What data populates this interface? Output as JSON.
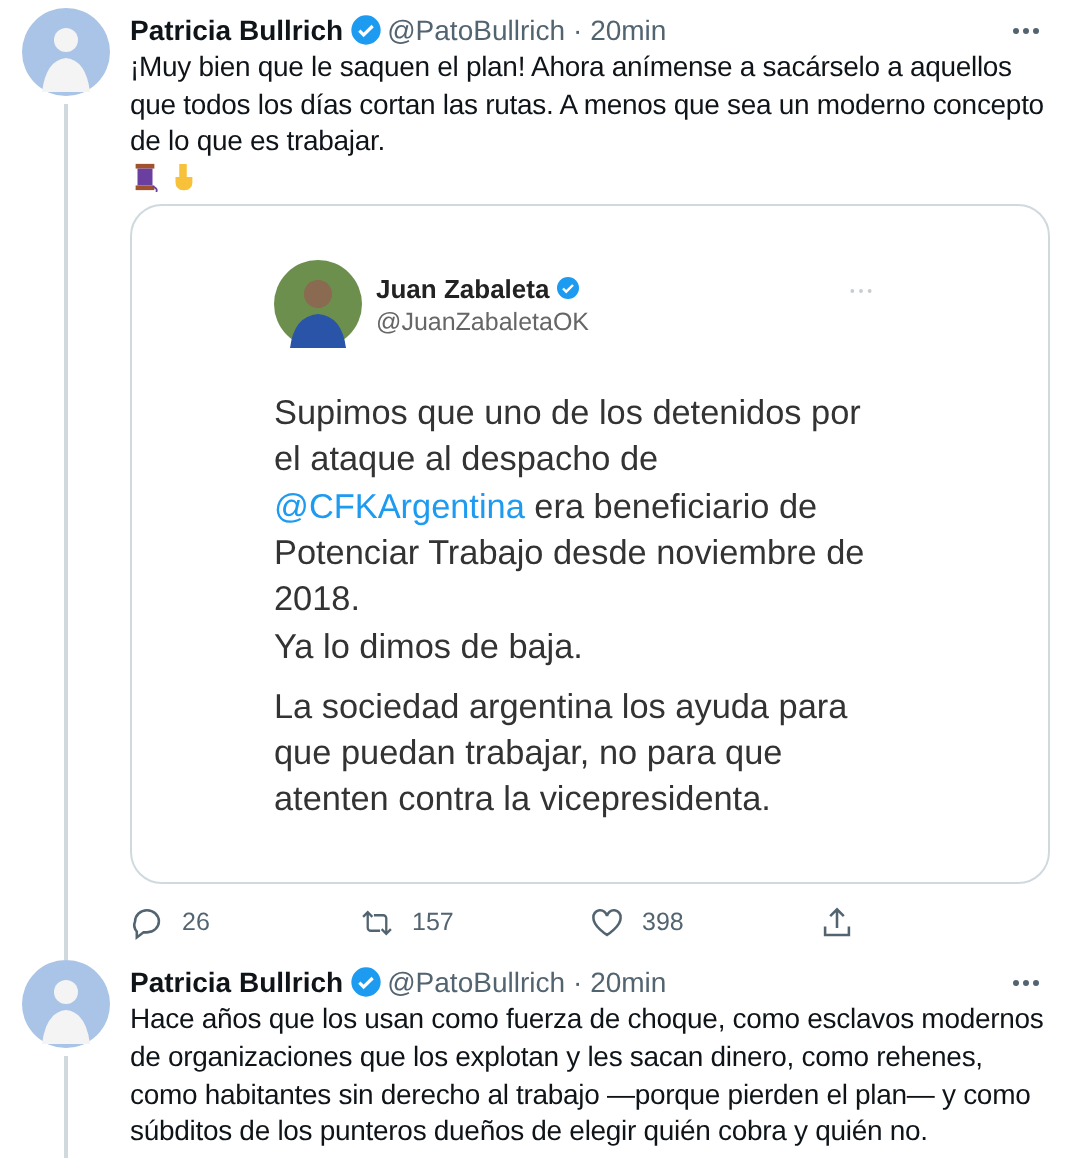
{
  "tweets": [
    {
      "name": "Patricia Bullrich",
      "verified": true,
      "handle": "@PatoBullrich",
      "time": "· 20min",
      "text": "¡Muy bien que le saquen el plan! Ahora anímense a sacárselo a aquellos que todos los días cortan las rutas. A menos que sea un moderno concepto de lo que es trabajar.",
      "emojis": [
        {
          "kind": "spool"
        },
        {
          "kind": "pointing_down"
        }
      ],
      "quote": {
        "name": "Juan Zabaleta",
        "verified": true,
        "handle": "@JuanZabaletaOK",
        "paragraphs": [
          [
            {
              "kind": "text",
              "text": "Supimos que uno de los detenidos por el ataque al despacho de "
            },
            {
              "kind": "mention",
              "text": "@CFKArgentina"
            },
            {
              "kind": "text",
              "text": " era beneficiario de Potenciar Trabajo desde noviembre de 2018."
            }
          ],
          [
            {
              "kind": "text",
              "text": "Ya lo dimos de baja."
            }
          ],
          [
            {
              "kind": "text",
              "text": "La sociedad argentina los ayuda para que puedan trabajar, no para que atenten contra la vicepresidenta."
            }
          ]
        ]
      },
      "actions": {
        "replies": "26",
        "retweets": "157",
        "likes": "398"
      }
    },
    {
      "name": "Patricia Bullrich",
      "verified": true,
      "handle": "@PatoBullrich",
      "time": "· 20min",
      "text": "Hace años que los usan como fuerza de choque, como esclavos modernos de organizaciones que los explotan y les sacan dinero, como rehenes, como habitantes sin derecho al trabajo —porque pierden el plan— y como súbditos de los punteros dueños de elegir quién cobra y quién no."
    }
  ]
}
